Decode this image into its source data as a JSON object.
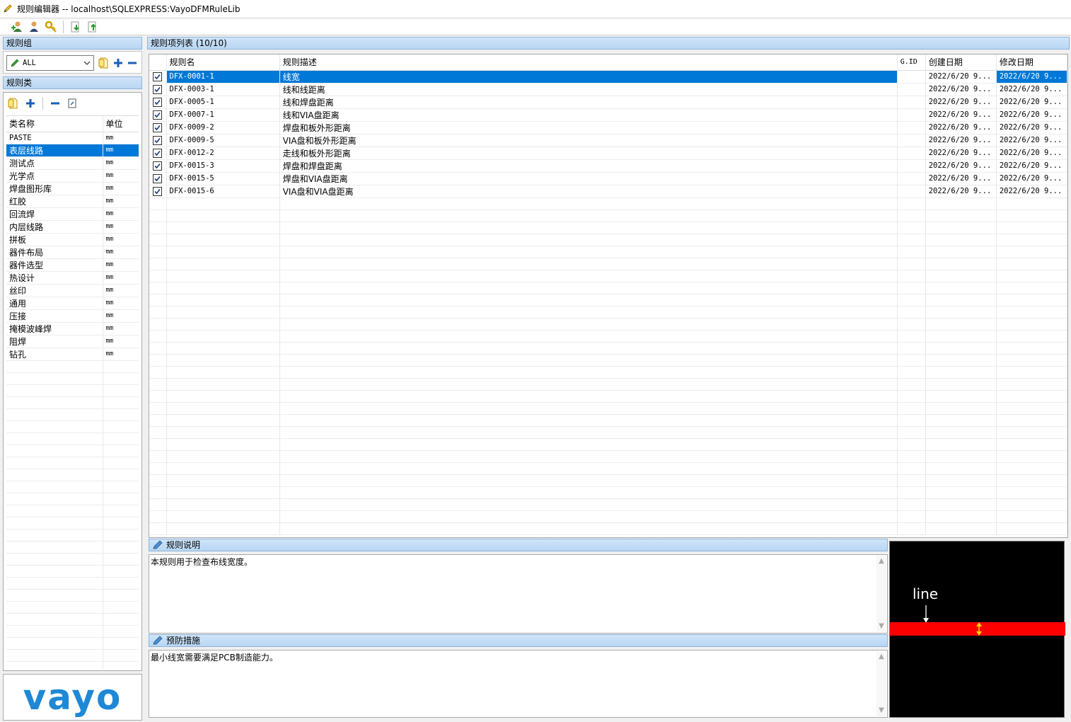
{
  "window": {
    "title": "规则编辑器  --  localhost\\SQLEXPRESS:VayoDFMRuleLib"
  },
  "left": {
    "rule_group_header": "规则组",
    "rule_group_select_value": "ALL",
    "rule_class_header": "规则类",
    "class_table": {
      "columns": [
        "类名称",
        "单位"
      ],
      "rows": [
        {
          "name": "PASTE",
          "unit": "mm"
        },
        {
          "name": "表层线路",
          "unit": "mm"
        },
        {
          "name": "测试点",
          "unit": "mm"
        },
        {
          "name": "光学点",
          "unit": "mm"
        },
        {
          "name": "焊盘图形库",
          "unit": "mm"
        },
        {
          "name": "红胶",
          "unit": "mm"
        },
        {
          "name": "回流焊",
          "unit": "mm"
        },
        {
          "name": "内层线路",
          "unit": "mm"
        },
        {
          "name": "拼板",
          "unit": "mm"
        },
        {
          "name": "器件布局",
          "unit": "mm"
        },
        {
          "name": "器件选型",
          "unit": "mm"
        },
        {
          "name": "热设计",
          "unit": "mm"
        },
        {
          "name": "丝印",
          "unit": "mm"
        },
        {
          "name": "通用",
          "unit": "mm"
        },
        {
          "name": "压接",
          "unit": "mm"
        },
        {
          "name": "掩模波峰焊",
          "unit": "mm"
        },
        {
          "name": "阻焊",
          "unit": "mm"
        },
        {
          "name": "钻孔",
          "unit": "mm"
        }
      ]
    },
    "logo_text": "vayo"
  },
  "main": {
    "rule_list_header": "规则项列表 (10/10)",
    "rule_table": {
      "columns": [
        "规则名",
        "规则描述",
        "G.ID",
        "创建日期",
        "修改日期"
      ],
      "rows": [
        {
          "name": "DFX-0001-1",
          "desc": "线宽",
          "gid": "",
          "created": "2022/6/20 9...",
          "modified": "2022/6/20 9..."
        },
        {
          "name": "DFX-0003-1",
          "desc": "线和线距离",
          "gid": "",
          "created": "2022/6/20 9...",
          "modified": "2022/6/20 9..."
        },
        {
          "name": "DFX-0005-1",
          "desc": "线和焊盘距离",
          "gid": "",
          "created": "2022/6/20 9...",
          "modified": "2022/6/20 9..."
        },
        {
          "name": "DFX-0007-1",
          "desc": "线和VIA盘距离",
          "gid": "",
          "created": "2022/6/20 9...",
          "modified": "2022/6/20 9..."
        },
        {
          "name": "DFX-0009-2",
          "desc": "焊盘和板外形距离",
          "gid": "",
          "created": "2022/6/20 9...",
          "modified": "2022/6/20 9..."
        },
        {
          "name": "DFX-0009-5",
          "desc": "VIA盘和板外形距离",
          "gid": "",
          "created": "2022/6/20 9...",
          "modified": "2022/6/20 9..."
        },
        {
          "name": "DFX-0012-2",
          "desc": "走线和板外形距离",
          "gid": "",
          "created": "2022/6/20 9...",
          "modified": "2022/6/20 9..."
        },
        {
          "name": "DFX-0015-3",
          "desc": "焊盘和焊盘距离",
          "gid": "",
          "created": "2022/6/20 9...",
          "modified": "2022/6/20 9..."
        },
        {
          "name": "DFX-0015-5",
          "desc": "焊盘和VIA盘距离",
          "gid": "",
          "created": "2022/6/20 9...",
          "modified": "2022/6/20 9..."
        },
        {
          "name": "DFX-0015-6",
          "desc": "VIA盘和VIA盘距离",
          "gid": "",
          "created": "2022/6/20 9...",
          "modified": "2022/6/20 9..."
        }
      ]
    },
    "description_header": "规则说明",
    "description_text": "本规则用于检查布线宽度。",
    "prevention_header": "预防措施",
    "prevention_text": "最小线宽需要满足PCB制造能力。",
    "preview_label": "line"
  },
  "colors": {
    "selection": "#0078d7",
    "header_blue": "#b8d6f3",
    "preview_bg": "#000000",
    "preview_line": "#ff0000",
    "logo": "#1e88d6"
  }
}
